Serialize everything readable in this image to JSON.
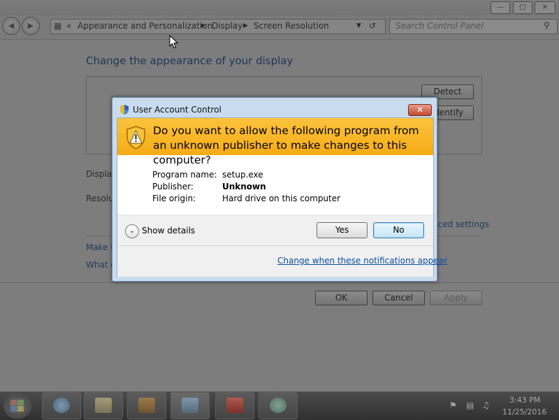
{
  "background_window": {
    "breadcrumb": [
      "Appearance and Personalization",
      "Display",
      "Screen Resolution"
    ],
    "breadcrumb_prefix": "«",
    "search_placeholder": "Search Control Panel",
    "page_heading": "Change the appearance of your display",
    "detect_label": "Detect",
    "identify_label": "Identify",
    "display_label": "Display",
    "resolution_label": "Resolution",
    "advanced_settings_label": "Advanced settings",
    "make_link": "Make t",
    "what_link": "What d",
    "ok_label": "OK",
    "cancel_label": "Cancel",
    "apply_label": "Apply",
    "window_buttons": [
      "—",
      "□",
      "✕"
    ]
  },
  "uac": {
    "title": "User Account Control",
    "question": "Do you want to allow the following program from an unknown publisher to make changes to this computer?",
    "fields": [
      {
        "label": "Program name:",
        "value": "setup.exe",
        "bold": false
      },
      {
        "label": "Publisher:",
        "value": "Unknown",
        "bold": true
      },
      {
        "label": "File origin:",
        "value": "Hard drive on this computer",
        "bold": false
      }
    ],
    "show_details_label": "Show details",
    "yes_label": "Yes",
    "no_label": "No",
    "notifications_link": "Change when these notifications appear",
    "close_glyph": "✕"
  },
  "taskbar": {
    "time": "3:43 PM",
    "date": "11/25/2016",
    "apps": [
      "internet-explorer-icon",
      "file-explorer-icon",
      "media-player-icon",
      "control-panel-icon",
      "toolbox-icon",
      "setup-icon"
    ]
  },
  "colors": {
    "uac_banner": "#f4ac16",
    "link_blue": "#0a4fa3",
    "dialog_frame": "#c9dcef"
  }
}
